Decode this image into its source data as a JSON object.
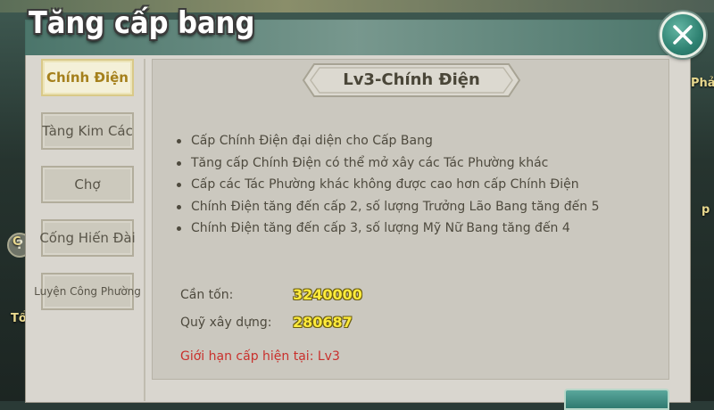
{
  "title": "Tăng cấp bang",
  "close_icon": "close-icon",
  "sidebar": {
    "items": [
      {
        "label": "Chính Điện",
        "active": true
      },
      {
        "label": "Tàng Kim Các",
        "active": false
      },
      {
        "label": "Chợ",
        "active": false
      },
      {
        "label": "Cống Hiến Đài",
        "active": false
      },
      {
        "label": "Luyện Công Phường",
        "active": false
      }
    ]
  },
  "content": {
    "banner_title": "Lv3-Chính Điện",
    "bullets": [
      "Cấp Chính Điện đại diện cho Cấp Bang",
      "Tăng cấp Chính Điện có thể mở xây các Tác Phường khác",
      "Cấp các Tác Phường khác không được cao hơn cấp Chính Điện",
      "Chính Điện tăng đến cấp 2, số lượng Trưởng Lão Bang tăng đến 5",
      "Chính Điện tăng đến cấp 3, số lượng Mỹ Nữ Bang tăng đến 4"
    ],
    "cost_label": "Cần tốn:",
    "cost_value": "3240000",
    "fund_label": "Quỹ xây dựng:",
    "fund_value": "280687",
    "limit_text": "Giới hạn cấp hiện tại: Lv3"
  },
  "background": {
    "badge": "?",
    "peek_right_1": "Phả",
    "peek_right_2": "p",
    "peek_left_1": "C",
    "peek_left_2": "Tổ"
  },
  "colors": {
    "header_teal": "#3f6d62",
    "accent_gold": "#a5801c",
    "value_yellow": "#ffeb3b",
    "warning_red": "#c9302c"
  }
}
